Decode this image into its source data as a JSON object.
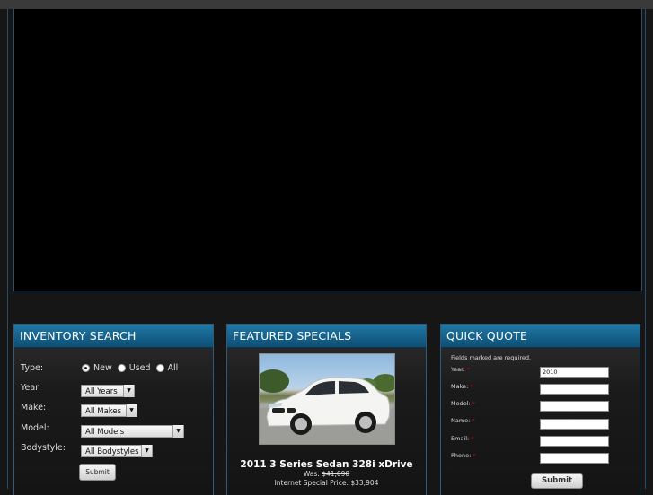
{
  "inventory_search": {
    "title": "INVENTORY SEARCH",
    "type_label": "Type:",
    "type_options": [
      "New",
      "Used",
      "All"
    ],
    "year_label": "Year:",
    "year_value": "All Years",
    "make_label": "Make:",
    "make_value": "All Makes",
    "model_label": "Model:",
    "model_value": "All Models",
    "bodystyle_label": "Bodystyle:",
    "bodystyle_value": "All Bodystyles",
    "submit_label": "Submit"
  },
  "featured_specials": {
    "title": "FEATURED SPECIALS",
    "car_title": "2011 3 Series Sedan 328i xDrive",
    "was_label": "Was:",
    "was_price": "$41,090",
    "special_label": "Internet Special Price: $33,904"
  },
  "quick_quote": {
    "title": "QUICK QUOTE",
    "note": "Fields marked    are required.",
    "year_label": "Year:",
    "year_value": "2010",
    "make_label": "Make:",
    "model_label": "Model:",
    "name_label": "Name:",
    "email_label": "Email:",
    "phone_label": "Phone:",
    "required_mark": "*",
    "submit_label": "Submit"
  }
}
